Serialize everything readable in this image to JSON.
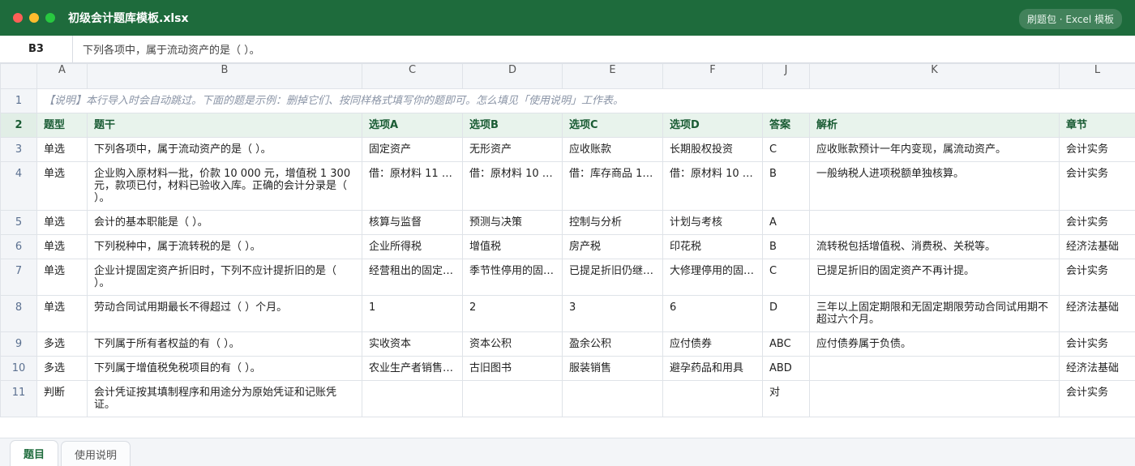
{
  "window": {
    "title": "初级会计题库模板.xlsx",
    "badge": "刷题包 · Excel 模板",
    "accent": "#1e6b3c"
  },
  "formula_bar": {
    "cell_ref": "B3",
    "content": "下列各项中，属于流动资产的是（ ）。"
  },
  "columns": [
    "A",
    "B",
    "C",
    "D",
    "E",
    "F",
    "J",
    "K",
    "L"
  ],
  "note_row": {
    "num": "1",
    "text": "【说明】本行导入时会自动跳过。下面的题是示例：删掉它们、按同样格式填写你的题即可。怎么填见「使用说明」工作表。"
  },
  "header_row": {
    "num": "2",
    "cells": [
      "题型",
      "题干",
      "选项A",
      "选项B",
      "选项C",
      "选项D",
      "答案",
      "解析",
      "章节"
    ]
  },
  "rows": [
    {
      "num": "3",
      "cells": [
        "单选",
        "下列各项中，属于流动资产的是（ ）。",
        "固定资产",
        "无形资产",
        "应收账款",
        "长期股权投资",
        "C",
        "应收账款预计一年内变现，属流动资产。",
        "会计实务"
      ]
    },
    {
      "num": "4",
      "cells": [
        "单选",
        "企业购入原材料一批，价款 10 000 元，增值税 1 300 元，款项已付，材料已验收入库。正确的会计分录是（ ）。",
        "借：原材料 11 3…",
        "借：原材料 10 …",
        "借：库存商品 1…",
        "借：原材料 10 …",
        "B",
        "一般纳税人进项税额单独核算。",
        "会计实务"
      ]
    },
    {
      "num": "5",
      "cells": [
        "单选",
        "会计的基本职能是（ ）。",
        "核算与监督",
        "预测与决策",
        "控制与分析",
        "计划与考核",
        "A",
        "",
        "会计实务"
      ]
    },
    {
      "num": "6",
      "cells": [
        "单选",
        "下列税种中，属于流转税的是（ ）。",
        "企业所得税",
        "增值税",
        "房产税",
        "印花税",
        "B",
        "流转税包括增值税、消费税、关税等。",
        "经济法基础"
      ]
    },
    {
      "num": "7",
      "cells": [
        "单选",
        "企业计提固定资产折旧时，下列不应计提折旧的是（ ）。",
        "经营租出的固定…",
        "季节性停用的固…",
        "已提足折旧仍继…",
        "大修理停用的固…",
        "C",
        "已提足折旧的固定资产不再计提。",
        "会计实务"
      ]
    },
    {
      "num": "8",
      "cells": [
        "单选",
        "劳动合同试用期最长不得超过（ ）个月。",
        "1",
        "2",
        "3",
        "6",
        "D",
        "三年以上固定期限和无固定期限劳动合同试用期不超过六个月。",
        "经济法基础"
      ]
    },
    {
      "num": "9",
      "cells": [
        "多选",
        "下列属于所有者权益的有（ ）。",
        "实收资本",
        "资本公积",
        "盈余公积",
        "应付债券",
        "ABC",
        "应付债券属于负债。",
        "会计实务"
      ]
    },
    {
      "num": "10",
      "cells": [
        "多选",
        "下列属于增值税免税项目的有（ ）。",
        "农业生产者销售…",
        "古旧图书",
        "服装销售",
        "避孕药品和用具",
        "ABD",
        "",
        "经济法基础"
      ]
    },
    {
      "num": "11",
      "cells": [
        "判断",
        "会计凭证按其填制程序和用途分为原始凭证和记账凭证。",
        "",
        "",
        "",
        "",
        "对",
        "",
        "会计实务"
      ]
    }
  ],
  "tabs": [
    {
      "label": "题目",
      "active": true
    },
    {
      "label": "使用说明",
      "active": false
    }
  ]
}
